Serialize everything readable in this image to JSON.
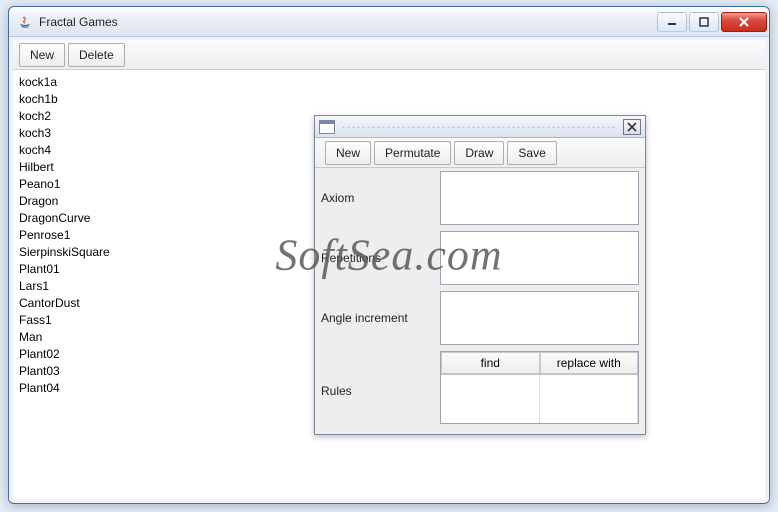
{
  "window": {
    "title": "Fractal Games"
  },
  "toolbar": {
    "new_label": "New",
    "delete_label": "Delete"
  },
  "fractals": [
    "kock1a",
    "koch1b",
    "koch2",
    "koch3",
    "koch4",
    "Hilbert",
    "Peano1",
    "Dragon",
    "DragonCurve",
    "Penrose1",
    "SierpinskiSquare",
    "Plant01",
    "Lars1",
    "CantorDust",
    "Fass1",
    "Man",
    "Plant02",
    "Plant03",
    "Plant04"
  ],
  "internal": {
    "toolbar": {
      "new_label": "New",
      "permutate_label": "Permutate",
      "draw_label": "Draw",
      "save_label": "Save"
    },
    "labels": {
      "axiom": "Axiom",
      "repetitions": "Repetitions",
      "angle_increment": "Angle increment",
      "rules": "Rules"
    },
    "rules_headers": {
      "find": "find",
      "replace": "replace with"
    }
  },
  "watermark": "SoftSea.com"
}
